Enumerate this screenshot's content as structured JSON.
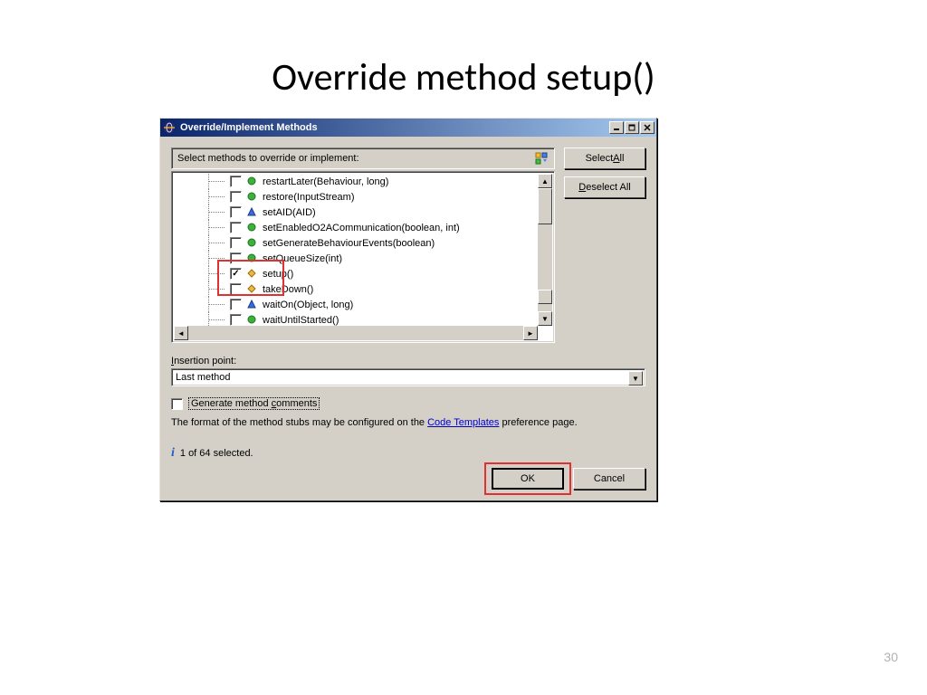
{
  "slide": {
    "title": "Override method setup()",
    "page_num": "30"
  },
  "dialog": {
    "title": "Override/Implement Methods",
    "instruction": "Select methods to override or implement:",
    "select_all": "Select All",
    "deselect_all": "Deselect All",
    "insertion_label": "Insertion point:",
    "insertion_value": "Last method",
    "gen_comments": "Generate method comments",
    "hint_before": "The format of the method stubs may be configured on the ",
    "hint_link": "Code Templates",
    "hint_after": " preference page.",
    "status": "1 of 64 selected.",
    "ok": "OK",
    "cancel": "Cancel"
  },
  "methods": [
    {
      "name": "restartLater(Behaviour, long)",
      "checked": false,
      "icon": "circle-green"
    },
    {
      "name": "restore(InputStream)",
      "checked": false,
      "icon": "circle-green"
    },
    {
      "name": "setAID(AID)",
      "checked": false,
      "icon": "triangle-blue"
    },
    {
      "name": "setEnabledO2ACommunication(boolean, int)",
      "checked": false,
      "icon": "circle-green"
    },
    {
      "name": "setGenerateBehaviourEvents(boolean)",
      "checked": false,
      "icon": "circle-green"
    },
    {
      "name": "setQueueSize(int)",
      "checked": false,
      "icon": "circle-green"
    },
    {
      "name": "setup()",
      "checked": true,
      "icon": "diamond-gold"
    },
    {
      "name": "takeDown()",
      "checked": false,
      "icon": "diamond-gold"
    },
    {
      "name": "waitOn(Object, long)",
      "checked": false,
      "icon": "triangle-blue"
    },
    {
      "name": "waitUntilStarted()",
      "checked": false,
      "icon": "circle-green"
    }
  ]
}
